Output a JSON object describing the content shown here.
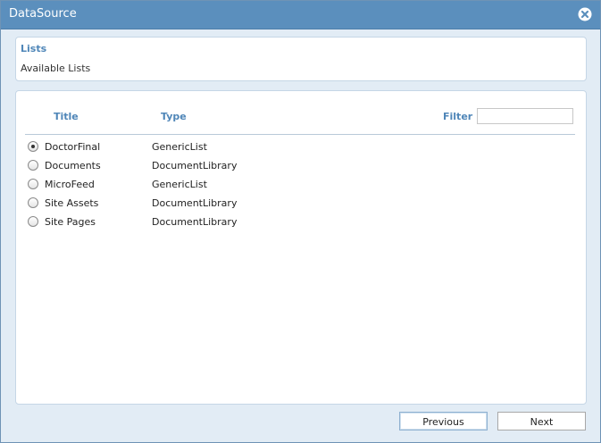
{
  "window": {
    "title": "DataSource",
    "close_icon": "close-icon"
  },
  "lists_panel": {
    "title": "Lists",
    "subtitle": "Available Lists"
  },
  "table": {
    "headers": {
      "title": "Title",
      "type": "Type"
    },
    "filter": {
      "label": "Filter",
      "value": "",
      "placeholder": ""
    },
    "rows": [
      {
        "title": "DoctorFinal",
        "type": "GenericList",
        "selected": true
      },
      {
        "title": "Documents",
        "type": "DocumentLibrary",
        "selected": false
      },
      {
        "title": "MicroFeed",
        "type": "GenericList",
        "selected": false
      },
      {
        "title": "Site Assets",
        "type": "DocumentLibrary",
        "selected": false
      },
      {
        "title": "Site Pages",
        "type": "DocumentLibrary",
        "selected": false
      }
    ]
  },
  "buttons": {
    "previous": "Previous",
    "next": "Next"
  },
  "colors": {
    "titlebar": "#5b8fbd",
    "accent": "#4f86b8",
    "background": "#e2ecf5"
  }
}
